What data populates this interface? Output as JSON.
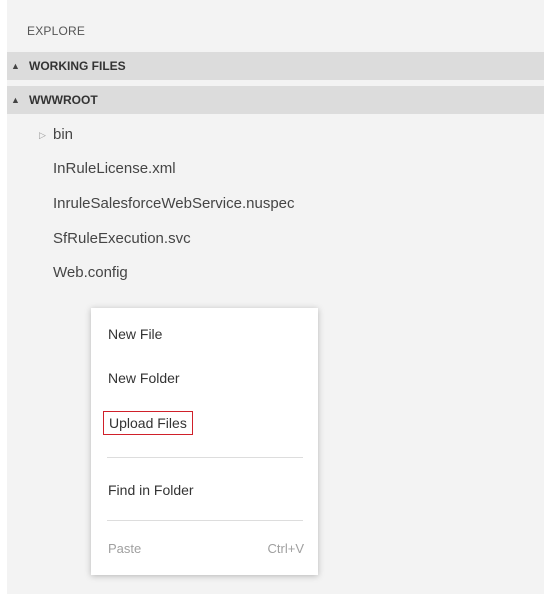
{
  "explorer": {
    "title": "EXPLORE",
    "sections": [
      {
        "label": "WORKING FILES",
        "arrow": "▲",
        "expanded": true
      },
      {
        "label": "WWWROOT",
        "arrow": "▲",
        "expanded": true
      }
    ],
    "tree": {
      "folder": {
        "label": "bin",
        "arrow": "▷",
        "expanded": false
      },
      "files": [
        "InRuleLicense.xml",
        "InruleSalesforceWebService.nuspec",
        "SfRuleExecution.svc",
        "Web.config"
      ]
    }
  },
  "context_menu": {
    "new_file": "New File",
    "new_folder": "New Folder",
    "upload_files": "Upload Files",
    "find_in_folder": "Find in Folder",
    "paste": {
      "label": "Paste",
      "shortcut": "Ctrl+V",
      "enabled": false
    }
  },
  "colors": {
    "highlight_border": "#d0202a",
    "section_background": "#dcdcdc",
    "panel_background": "#f3f3f3"
  }
}
